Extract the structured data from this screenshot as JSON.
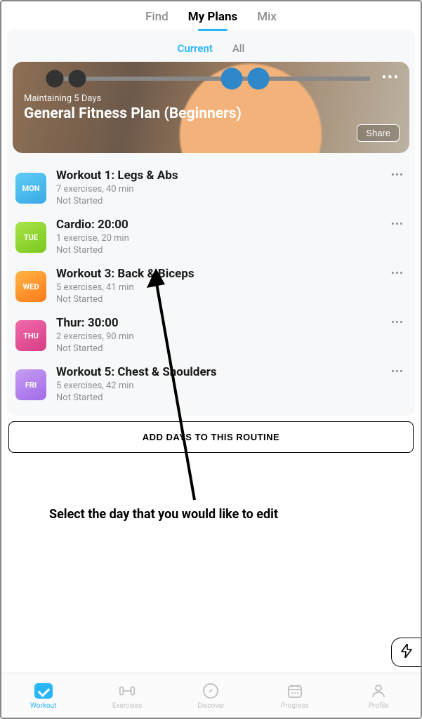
{
  "topTabs": {
    "find": "Find",
    "myPlans": "My Plans",
    "mix": "Mix"
  },
  "subTabs": {
    "current": "Current",
    "all": "All"
  },
  "hero": {
    "subtitle": "Maintaining  5 Days",
    "title": "General Fitness Plan (Beginners)",
    "share": "Share"
  },
  "workouts": [
    {
      "day": "MON",
      "title": "Workout 1: Legs & Abs",
      "meta": "7 exercises, 40 min",
      "status": "Not Started"
    },
    {
      "day": "TUE",
      "title": "Cardio: 20:00",
      "meta": "1 exercise, 20 min",
      "status": "Not Started"
    },
    {
      "day": "WED",
      "title": "Workout 3: Back & Biceps",
      "meta": "5 exercises, 41 min",
      "status": "Not Started"
    },
    {
      "day": "THU",
      "title": "Thur: 30:00",
      "meta": "2 exercises, 90 min",
      "status": "Not Started"
    },
    {
      "day": "FRI",
      "title": "Workout 5: Chest & Shoulders",
      "meta": "5 exercises, 42 min",
      "status": "Not Started"
    }
  ],
  "addDays": "ADD DAYS TO THIS ROUTINE",
  "annotation": "Select the day that you would like to edit",
  "bottomBar": {
    "workout": "Workout",
    "exercises": "Exercises",
    "discover": "Discover",
    "progress": "Progress",
    "profile": "Profile"
  }
}
